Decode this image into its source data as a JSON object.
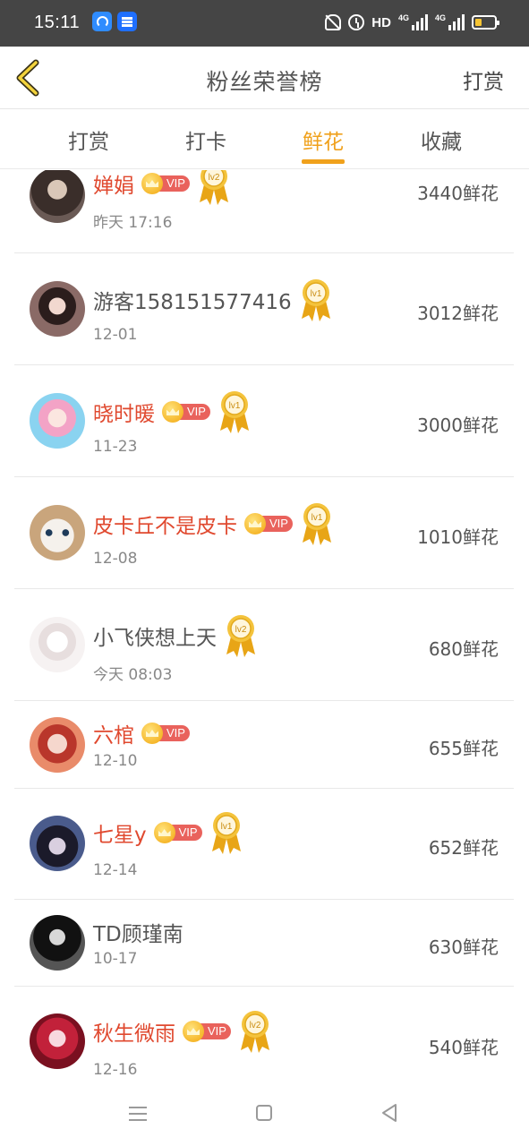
{
  "status_bar": {
    "time": "15:11",
    "network_label": "HD",
    "signal1_label": "4G",
    "signal2_label": "4G"
  },
  "nav": {
    "title": "粉丝荣誉榜",
    "action": "打赏"
  },
  "tabs": [
    {
      "label": "打赏",
      "active": false
    },
    {
      "label": "打卡",
      "active": false
    },
    {
      "label": "鲜花",
      "active": true
    },
    {
      "label": "收藏",
      "active": false
    }
  ],
  "colors": {
    "accent": "#f0a11c",
    "vip_name": "#e0492f",
    "status_bar": "#454545",
    "vip_badge": "#e9625c"
  },
  "vip_label": "VIP",
  "list": [
    {
      "name": "婵娟",
      "vip": true,
      "level": "lv2",
      "date": "昨天 17:16",
      "flowers": "3440鲜花"
    },
    {
      "name": "游客158151577416",
      "vip": false,
      "level": "lv1",
      "date": "12-01",
      "flowers": "3012鲜花"
    },
    {
      "name": "晓时暖",
      "vip": true,
      "level": "lv1",
      "date": "11-23",
      "flowers": "3000鲜花"
    },
    {
      "name": "皮卡丘不是皮卡",
      "vip": true,
      "level": "lv1",
      "date": "12-08",
      "flowers": "1010鲜花"
    },
    {
      "name": "小飞侠想上天",
      "vip": false,
      "level": "lv2",
      "date": "今天 08:03",
      "flowers": "680鲜花"
    },
    {
      "name": "六棺",
      "vip": true,
      "level": "",
      "date": "12-10",
      "flowers": "655鲜花"
    },
    {
      "name": "七星y",
      "vip": true,
      "level": "lv1",
      "date": "12-14",
      "flowers": "652鲜花"
    },
    {
      "name": "TD顾瑾南",
      "vip": false,
      "level": "",
      "date": "10-17",
      "flowers": "630鲜花"
    },
    {
      "name": "秋生微雨",
      "vip": true,
      "level": "lv2",
      "date": "12-16",
      "flowers": "540鲜花"
    }
  ],
  "icons": {
    "back": "chevron-left-icon",
    "vip": "crown-icon",
    "medal": "medal-icon",
    "sys_menu": "menu-icon",
    "sys_home": "square-home-icon",
    "sys_back": "triangle-back-icon"
  }
}
